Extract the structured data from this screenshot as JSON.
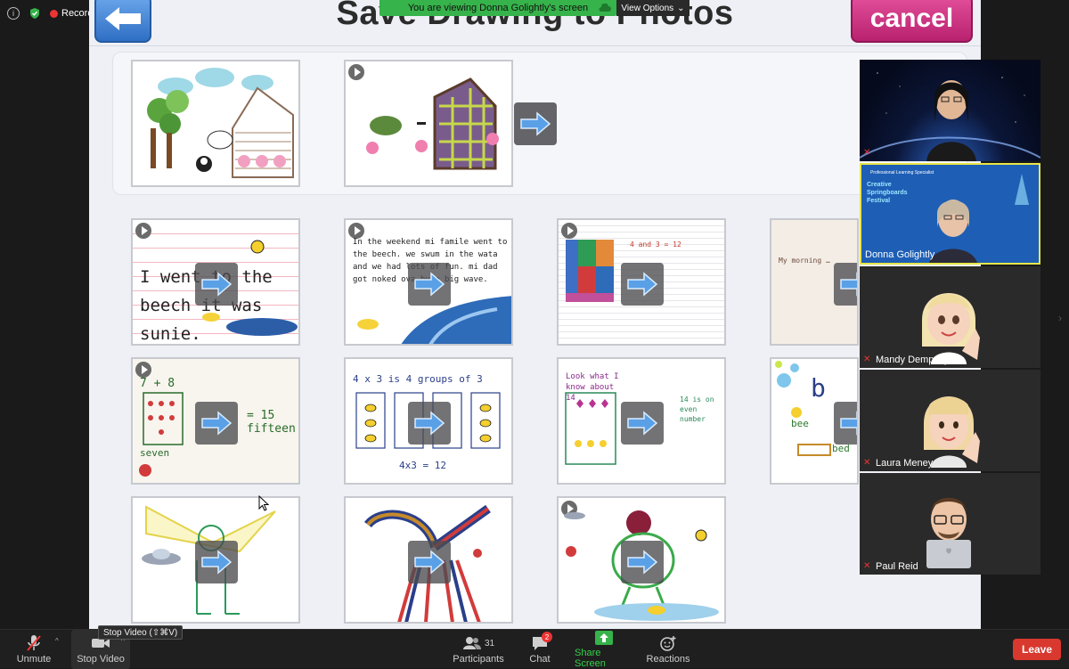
{
  "screen_share": {
    "banner_text": "You are viewing Donna Golightly's screen",
    "view_options_label": "View Options",
    "app": {
      "title": "Save Drawing to Photos",
      "cancel_label": "cancel"
    },
    "thumbnails": {
      "row2": [
        {
          "text": "I went to the beech it was sunie."
        },
        {
          "text": "In the weekend mi famile went to the beech. we swum in the wata and we had lots of fun. mi dad got noked ova by a big wave."
        },
        {
          "text": "4 and 3 = 12"
        },
        {
          "text": "My morning …"
        }
      ],
      "row3": [
        {
          "text": "7 + 8",
          "result": "= 15 fifteen",
          "label": "seven"
        },
        {
          "text": "4 x 3 is 4 groups of 3",
          "result": "4x3 = 12"
        },
        {
          "text": "Look what I know about 14",
          "result": "14 is on even number"
        },
        {
          "text": "b",
          "label": "bee",
          "label2": "bed"
        }
      ]
    }
  },
  "top_left": {
    "recording_label": "Recording"
  },
  "participants_panel": [
    {
      "name": "",
      "kind": "camera"
    },
    {
      "name": "Donna Golightly",
      "kind": "camera",
      "slide_title": "Creative Springboards Festival",
      "slide_sub": "Professional Learning Specialist"
    },
    {
      "name": "Mandy Dempsey",
      "kind": "memoji"
    },
    {
      "name": "Laura Meney",
      "kind": "memoji"
    },
    {
      "name": "Paul Reid",
      "kind": "memoji"
    }
  ],
  "toolbar": {
    "unmute_label": "Unmute",
    "stop_video_label": "Stop Video",
    "stop_video_tooltip": "Stop Video (⇧⌘V)",
    "participants_label": "Participants",
    "participants_count": "31",
    "chat_label": "Chat",
    "chat_badge": "2",
    "share_screen_label": "Share Screen",
    "reactions_label": "Reactions",
    "leave_label": "Leave"
  },
  "colors": {
    "share_green": "#36b34a",
    "leave_red": "#d9382f",
    "cancel_pink": "#d0307f",
    "highlight_yellow": "#e9e54a"
  }
}
